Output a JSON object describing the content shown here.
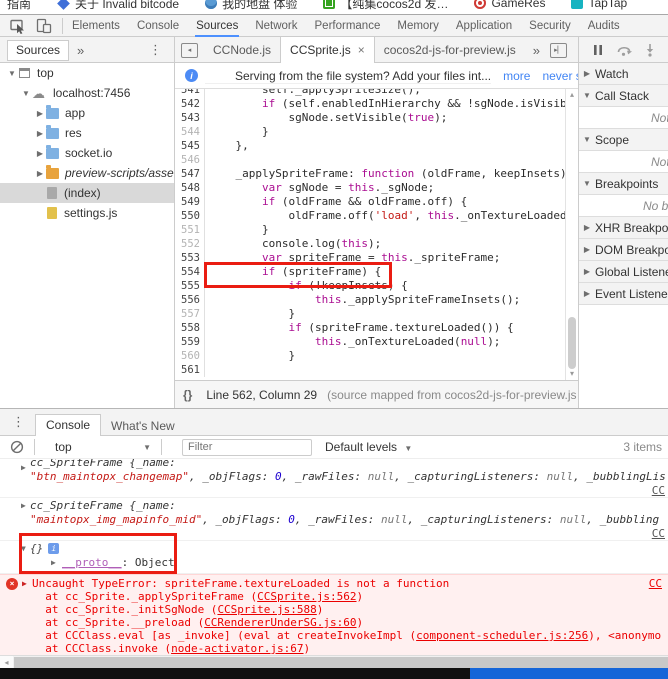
{
  "bookmarks": {
    "items": [
      {
        "icon": "clipped",
        "label": "指南"
      },
      {
        "icon": "diamond",
        "label": "关于 Invalid bitcode"
      },
      {
        "icon": "globe",
        "label": "我的地盘 体验"
      },
      {
        "icon": "green-app",
        "label": "【纯集cocos2d 发…"
      },
      {
        "icon": "gameres",
        "label": "GameRes"
      },
      {
        "icon": "taptap",
        "label": "TapTap"
      }
    ]
  },
  "toolbar": {
    "tabs": [
      "Elements",
      "Console",
      "Sources",
      "Network",
      "Performance",
      "Memory",
      "Application",
      "Security",
      "Audits"
    ],
    "active_tab": "Sources"
  },
  "nav": {
    "tab": "Sources",
    "overflow": "»",
    "menu": "⋮"
  },
  "tree": {
    "items": [
      {
        "depth": 0,
        "exp": "▼",
        "icon": "frame",
        "label": "top"
      },
      {
        "depth": 1,
        "exp": "▼",
        "icon": "cloud",
        "label": "localhost:7456"
      },
      {
        "depth": 2,
        "exp": "▶",
        "icon": "folder-blue",
        "label": "app"
      },
      {
        "depth": 2,
        "exp": "▶",
        "icon": "folder-blue",
        "label": "res"
      },
      {
        "depth": 2,
        "exp": "▶",
        "icon": "folder-blue",
        "label": "socket.io"
      },
      {
        "depth": 2,
        "exp": "▶",
        "icon": "folder-orange",
        "label": "preview-scripts/assets",
        "italic": true
      },
      {
        "depth": 2,
        "exp": "",
        "icon": "file-gray",
        "label": "(index)",
        "selected": true
      },
      {
        "depth": 2,
        "exp": "",
        "icon": "file-js",
        "label": "settings.js"
      }
    ]
  },
  "editor": {
    "tabs": [
      {
        "label": "CCNode.js",
        "active": false
      },
      {
        "label": "CCSprite.js",
        "active": true,
        "close": "×"
      },
      {
        "label": "cocos2d-js-for-preview.js",
        "active": false
      }
    ],
    "overflow": "»",
    "infobar": {
      "text": "Serving from the file system? Add your files int...",
      "more": "more",
      "never_show": "never show",
      "close": "×"
    },
    "status": {
      "braces": "{}",
      "position": "Line 562, Column 29",
      "mapped": "(source mapped from cocos2d-js-for-preview.js"
    },
    "lines": [
      {
        "n": "541",
        "dark": true,
        "t": [
          [
            "p",
            "        self._applySpriteSize();"
          ]
        ]
      },
      {
        "n": "542",
        "dark": true,
        "t": [
          [
            "p",
            "        "
          ],
          [
            "k",
            "if"
          ],
          [
            "p",
            " (self.enabledInHierarchy && !sgNode.isVisib"
          ]
        ]
      },
      {
        "n": "543",
        "dark": true,
        "t": [
          [
            "p",
            "            sgNode.setVisible("
          ],
          [
            "k",
            "true"
          ],
          [
            "p",
            ");"
          ]
        ]
      },
      {
        "n": "544",
        "dark": false,
        "t": [
          [
            "p",
            "        }"
          ]
        ]
      },
      {
        "n": "545",
        "dark": true,
        "t": [
          [
            "p",
            "    },"
          ]
        ]
      },
      {
        "n": "546",
        "dark": false,
        "t": []
      },
      {
        "n": "547",
        "dark": true,
        "t": [
          [
            "p",
            "    _applySpriteFrame: "
          ],
          [
            "k",
            "function"
          ],
          [
            "p",
            " (oldFrame, keepInsets)"
          ]
        ]
      },
      {
        "n": "548",
        "dark": true,
        "t": [
          [
            "p",
            "        "
          ],
          [
            "k",
            "var"
          ],
          [
            "p",
            " sgNode = "
          ],
          [
            "k",
            "this"
          ],
          [
            "p",
            "._sgNode;"
          ]
        ]
      },
      {
        "n": "549",
        "dark": true,
        "t": [
          [
            "p",
            "        "
          ],
          [
            "k",
            "if"
          ],
          [
            "p",
            " (oldFrame && oldFrame.off) {"
          ]
        ]
      },
      {
        "n": "550",
        "dark": true,
        "t": [
          [
            "p",
            "            oldFrame.off("
          ],
          [
            "s",
            "'load'"
          ],
          [
            "p",
            ", "
          ],
          [
            "k",
            "this"
          ],
          [
            "p",
            "._onTextureLoaded"
          ]
        ]
      },
      {
        "n": "551",
        "dark": false,
        "t": [
          [
            "p",
            "        }"
          ]
        ]
      },
      {
        "n": "552",
        "dark": false,
        "t": [
          [
            "p",
            "        console.log("
          ],
          [
            "k",
            "this"
          ],
          [
            "p",
            ");"
          ]
        ]
      },
      {
        "n": "553",
        "dark": true,
        "t": [
          [
            "p",
            "        "
          ],
          [
            "k",
            "var"
          ],
          [
            "p",
            " spriteFrame = "
          ],
          [
            "k",
            "this"
          ],
          [
            "p",
            "._spriteFrame;"
          ]
        ]
      },
      {
        "n": "554",
        "dark": true,
        "t": [
          [
            "p",
            "        "
          ],
          [
            "k",
            "if"
          ],
          [
            "p",
            " (spriteFrame) {"
          ]
        ]
      },
      {
        "n": "555",
        "dark": true,
        "t": [
          [
            "p",
            "            "
          ],
          [
            "k",
            "if"
          ],
          [
            "p",
            " (!keepInsets) {"
          ]
        ]
      },
      {
        "n": "556",
        "dark": true,
        "t": [
          [
            "p",
            "                "
          ],
          [
            "k",
            "this"
          ],
          [
            "p",
            "._applySpriteFrameInsets();"
          ]
        ]
      },
      {
        "n": "557",
        "dark": false,
        "t": [
          [
            "p",
            "            }"
          ]
        ]
      },
      {
        "n": "558",
        "dark": true,
        "t": [
          [
            "p",
            "            "
          ],
          [
            "k",
            "if"
          ],
          [
            "p",
            " (spriteFrame.textureLoaded()) {"
          ]
        ]
      },
      {
        "n": "559",
        "dark": true,
        "t": [
          [
            "p",
            "                "
          ],
          [
            "k",
            "this"
          ],
          [
            "p",
            "._onTextureLoaded("
          ],
          [
            "k",
            "null"
          ],
          [
            "p",
            ");"
          ]
        ]
      },
      {
        "n": "560",
        "dark": false,
        "t": [
          [
            "p",
            "            }"
          ]
        ]
      },
      {
        "n": "561",
        "dark": true,
        "t": []
      }
    ]
  },
  "debugger": {
    "sections": [
      {
        "label": "Watch",
        "exp": "▶"
      },
      {
        "label": "Call Stack",
        "exp": "▼",
        "content": "Not paused",
        "pad": 72
      },
      {
        "label": "Scope",
        "exp": "▼",
        "content": "Not paused",
        "pad": 72
      },
      {
        "label": "Breakpoints",
        "exp": "▼",
        "content": "No breakpoints",
        "pad": 64
      },
      {
        "label": "XHR Breakpoints",
        "exp": "▶"
      },
      {
        "label": "DOM Breakpoints",
        "exp": "▶"
      },
      {
        "label": "Global Listeners",
        "exp": "▶"
      },
      {
        "label": "Event Listener Breakpoints",
        "exp": "▶"
      }
    ]
  },
  "console": {
    "tabs": [
      "Console",
      "What's New"
    ],
    "active_tab": "Console",
    "menu": "⋮",
    "toolbar": {
      "context": "top",
      "filter_placeholder": "Filter",
      "levels": "Default levels",
      "count": "3 items"
    },
    "messages": [
      {
        "exp": "▶",
        "link": "CC",
        "lines": [
          [
            [
              "o",
              "cc_SpriteFrame {_name:"
            ]
          ],
          [
            [
              "s",
              "\"btn_maintopx_changemap\""
            ],
            [
              "o",
              ", _objFlags: "
            ],
            [
              "n",
              "0"
            ],
            [
              "o",
              ", _rawFiles: "
            ],
            [
              "u",
              "null"
            ],
            [
              "o",
              ", _capturingListeners: "
            ],
            [
              "u",
              "null"
            ],
            [
              "o",
              ", _bubblingLis"
            ]
          ]
        ]
      },
      {
        "exp": "▶",
        "link": "CC",
        "lines": [
          [
            [
              "o",
              "cc_SpriteFrame {_name:"
            ]
          ],
          [
            [
              "s",
              "\"maintopx_img_mapinfo_mid\""
            ],
            [
              "o",
              ", _objFlags: "
            ],
            [
              "n",
              "0"
            ],
            [
              "o",
              ", _rawFiles: "
            ],
            [
              "u",
              "null"
            ],
            [
              "o",
              ", _capturingListeners: "
            ],
            [
              "u",
              "null"
            ],
            [
              "o",
              ", _bubbling"
            ]
          ]
        ]
      },
      {
        "exp": "▼",
        "obj": "{}",
        "info": "i",
        "child_exp": "▶",
        "proto": "__proto__",
        "proto_val": ": Object"
      }
    ],
    "error": {
      "icon": "×",
      "exp": "▶",
      "link": "CC",
      "message": "Uncaught TypeError: spriteFrame.textureLoaded is not a function",
      "stack": [
        [
          [
            "t",
            "  at cc_Sprite._applySpriteFrame ("
          ],
          [
            "l",
            "CCSprite.js:562"
          ],
          [
            "t",
            ")"
          ]
        ],
        [
          [
            "t",
            "  at cc_Sprite._initSgNode ("
          ],
          [
            "l",
            "CCSprite.js:588"
          ],
          [
            "t",
            ")"
          ]
        ],
        [
          [
            "t",
            "  at cc_Sprite.__preload ("
          ],
          [
            "l",
            "CCRendererUnderSG.js:60"
          ],
          [
            "t",
            ")"
          ]
        ],
        [
          [
            "t",
            "  at CCClass.eval [as _invoke] (eval at createInvokeImpl ("
          ],
          [
            "l",
            "component-scheduler.js:256"
          ],
          [
            "t",
            "), <anonymo"
          ]
        ],
        [
          [
            "t",
            "  at CCClass.invoke ("
          ],
          [
            "l",
            "node-activator.js:67"
          ],
          [
            "t",
            ")"
          ]
        ]
      ]
    }
  },
  "colors": {
    "accent_blue": "#4d90fe",
    "error_red": "#eb0000",
    "error_bg": "#fff0f0",
    "annotation_red": "#ea1c12",
    "taskbar_blue": "#1565d8",
    "keyword": "#aa0d91",
    "string": "#c41a16"
  }
}
